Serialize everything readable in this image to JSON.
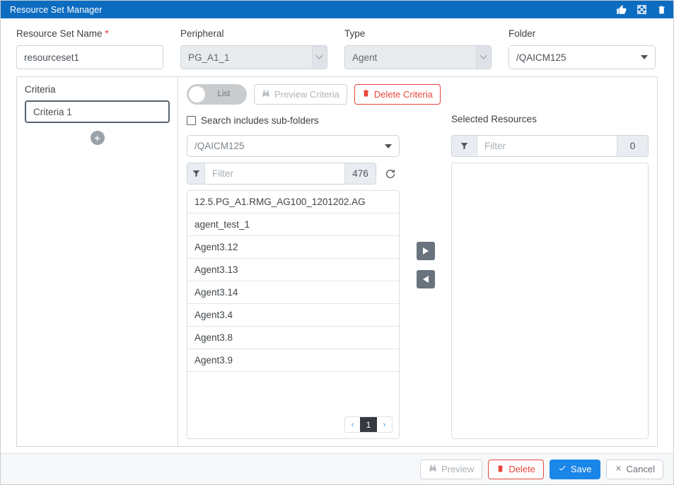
{
  "titlebar": {
    "title": "Resource Set Manager",
    "icons": [
      {
        "name": "thumbs-up-icon"
      },
      {
        "name": "expand-icon"
      },
      {
        "name": "trash-icon"
      }
    ],
    "background_color": "#0c6cc0"
  },
  "form": {
    "resource_set_name": {
      "label": "Resource Set Name",
      "required_marker": "*",
      "value": "resourceset1",
      "placeholder": ""
    },
    "peripheral": {
      "label": "Peripheral",
      "value": "PG_A1_1",
      "disabled": true
    },
    "type": {
      "label": "Type",
      "value": "Agent",
      "disabled": true
    },
    "folder": {
      "label": "Folder",
      "value": "/QAICM125",
      "disabled": false
    }
  },
  "criteria_panel": {
    "title": "Criteria",
    "items": [
      {
        "label": "Criteria 1",
        "selected": true
      }
    ],
    "add_button_name": "add-criteria-button"
  },
  "toolbar": {
    "toggle": {
      "label": "List",
      "state": "off"
    },
    "preview_criteria": {
      "label": "Preview Criteria",
      "icon": "binoculars-icon",
      "disabled": true
    },
    "delete_criteria": {
      "label": "Delete Criteria",
      "icon": "trash-icon",
      "color": "#e8453c"
    }
  },
  "search": {
    "sub_folders_checkbox": {
      "label": "Search includes sub-folders",
      "checked": false
    },
    "folder_select": {
      "value": "/QAICM125"
    },
    "filter": {
      "placeholder": "Filter",
      "value": "",
      "count": "476"
    },
    "refresh_icon": "refresh-icon"
  },
  "available_list": {
    "items": [
      "12.5.PG_A1.RMG_AG100_1201202.AG",
      "agent_test_1",
      "Agent3.12",
      "Agent3.13",
      "Agent3.14",
      "Agent3.4",
      "Agent3.8",
      "Agent3.9"
    ],
    "pagination": {
      "prev": "‹",
      "pages": [
        "1"
      ],
      "next": "›",
      "current": "1"
    }
  },
  "transfer": {
    "add_label": "▶",
    "remove_label": "◀"
  },
  "selected_resources": {
    "title": "Selected Resources",
    "filter": {
      "placeholder": "Filter",
      "value": "",
      "count": "0"
    },
    "items": []
  },
  "footer": {
    "preview": {
      "label": "Preview",
      "icon": "binoculars-icon",
      "disabled": true
    },
    "delete": {
      "label": "Delete",
      "icon": "trash-icon",
      "color": "#e8453c"
    },
    "save": {
      "label": "Save",
      "icon": "check-icon",
      "color": "#1a86e8"
    },
    "cancel": {
      "label": "Cancel",
      "icon": "close-icon"
    }
  }
}
